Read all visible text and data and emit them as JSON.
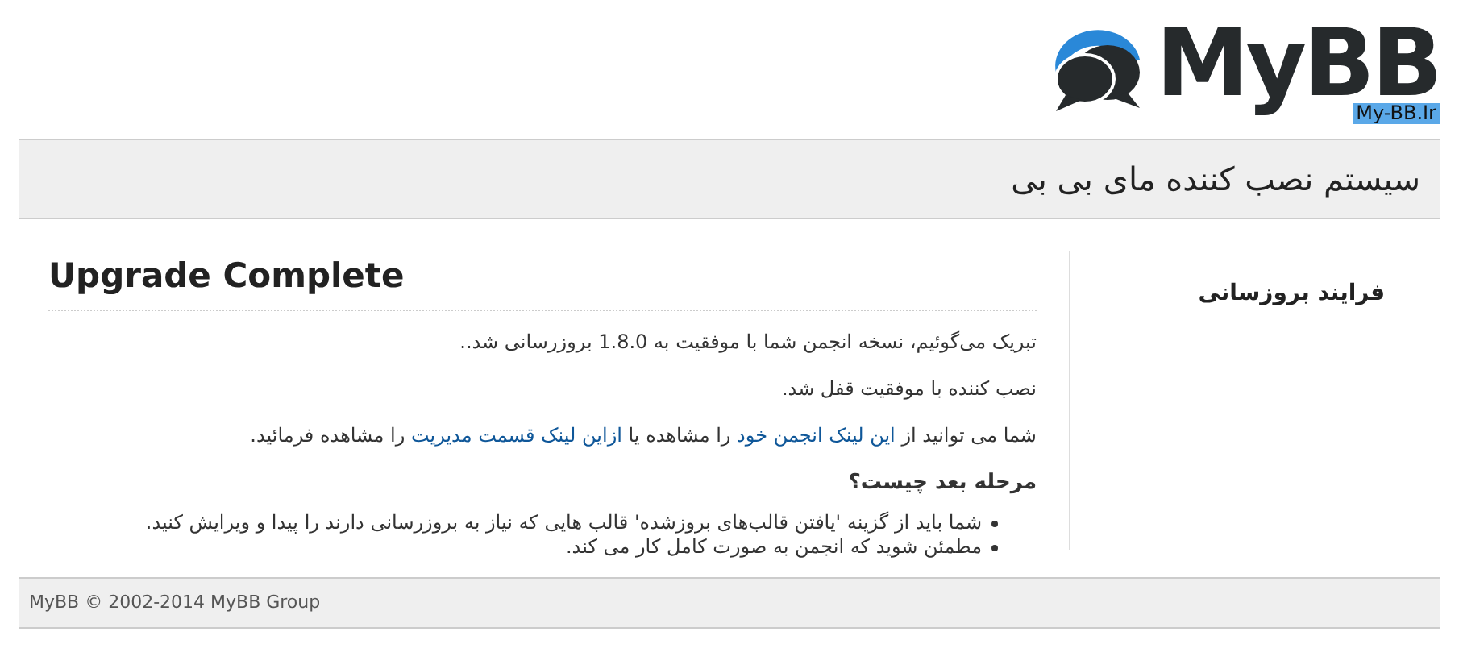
{
  "logo": {
    "name": "MyBB",
    "tag": "My-BB.Ir"
  },
  "header": {
    "title": "سیستم نصب کننده مای بی بی"
  },
  "sidebar": {
    "title": "فرایند بروزسانی"
  },
  "main": {
    "title": "Upgrade Complete",
    "paragraphs": [
      "تبریک می‌گوئیم، نسخه انجمن شما با موفقیت به 1.8.0 بروزرسانی شد..",
      "نصب کننده با موفقیت قفل شد."
    ],
    "links_paragraph": [
      {
        "kind": "text",
        "text": "شما می توانید از "
      },
      {
        "kind": "link",
        "text": "این لینک انجمن خود"
      },
      {
        "kind": "text",
        "text": " را مشاهده یا "
      },
      {
        "kind": "link",
        "text": "ازاین لینک قسمت مدیریت"
      },
      {
        "kind": "text",
        "text": " را مشاهده فرمائید."
      }
    ],
    "next_title": "مرحله بعد چیست؟",
    "next_items": [
      "شما باید از گزینه 'یافتن قالب‌های بروزشده' قالب هایی که نیاز به بروزرسانی دارند را پیدا و ویرایش کنید.",
      "مطمئن شوید که انجمن به صورت کامل کار می کند."
    ]
  },
  "footer": {
    "text": "MyBB © 2002-2014 MyBB Group"
  }
}
